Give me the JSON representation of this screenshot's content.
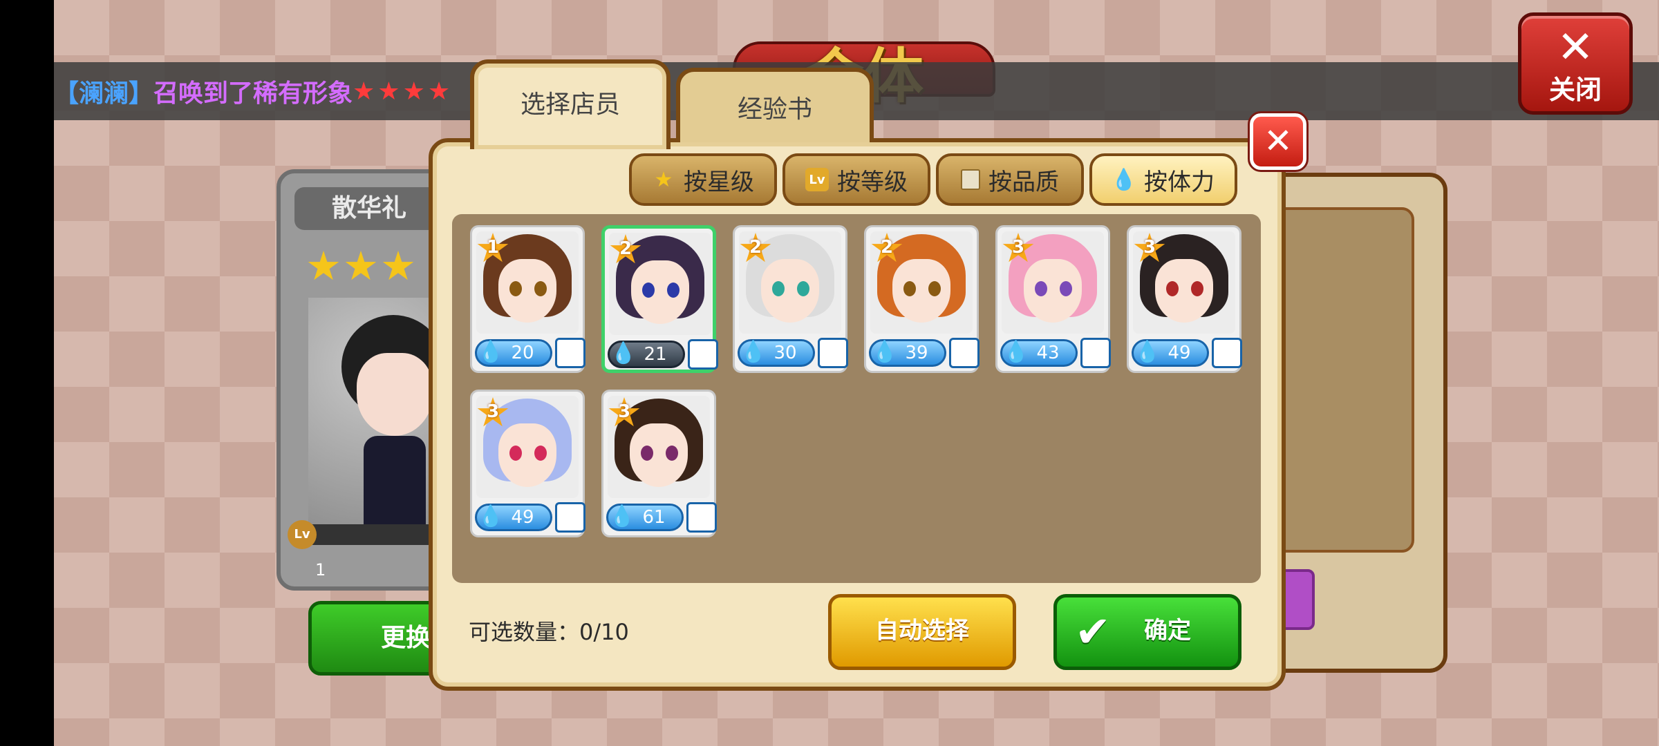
{
  "marquee": {
    "name": "【澜澜】",
    "text": "召唤到了稀有形象",
    "stars": "★★★★"
  },
  "banner": {
    "title": "合体"
  },
  "close_top": {
    "label": "关闭"
  },
  "left_panel": {
    "name": "散华礼",
    "stars": "★★★",
    "level": "1",
    "lv_badge": "Lv"
  },
  "change_button": {
    "label": "更换"
  },
  "tabs": [
    {
      "label": "选择店员",
      "active": true
    },
    {
      "label": "经验书",
      "active": false
    }
  ],
  "filters": [
    {
      "label": "按星级",
      "icon": "star-icon"
    },
    {
      "label": "按等级",
      "icon": "lv-icon"
    },
    {
      "label": "按品质",
      "icon": "card-icon"
    },
    {
      "label": "按体力",
      "icon": "drop-icon",
      "active": true
    }
  ],
  "staff": [
    {
      "rank": "1",
      "stamina": "20",
      "hair": "#6b3a1e",
      "eyes": "#8a5a12",
      "selected": false
    },
    {
      "rank": "2",
      "stamina": "21",
      "hair": "#3a2a4a",
      "eyes": "#2b3aa8",
      "selected": true
    },
    {
      "rank": "2",
      "stamina": "30",
      "hair": "#dcdcdc",
      "eyes": "#2ea89a",
      "selected": false
    },
    {
      "rank": "2",
      "stamina": "39",
      "hair": "#d46a22",
      "eyes": "#8a5a12",
      "selected": false
    },
    {
      "rank": "3",
      "stamina": "43",
      "hair": "#f3a0c0",
      "eyes": "#7a4ab8",
      "selected": false
    },
    {
      "rank": "3",
      "stamina": "49",
      "hair": "#2a2222",
      "eyes": "#b02828",
      "selected": false
    },
    {
      "rank": "3",
      "stamina": "49",
      "hair": "#a8b8f0",
      "eyes": "#d42a5a",
      "selected": false
    },
    {
      "rank": "3",
      "stamina": "61",
      "hair": "#3a2418",
      "eyes": "#7a2a6a",
      "selected": false
    }
  ],
  "selection": {
    "label": "可选数量：0/10"
  },
  "auto_button": {
    "label": "自动选择"
  },
  "confirm_button": {
    "label": "确定"
  }
}
